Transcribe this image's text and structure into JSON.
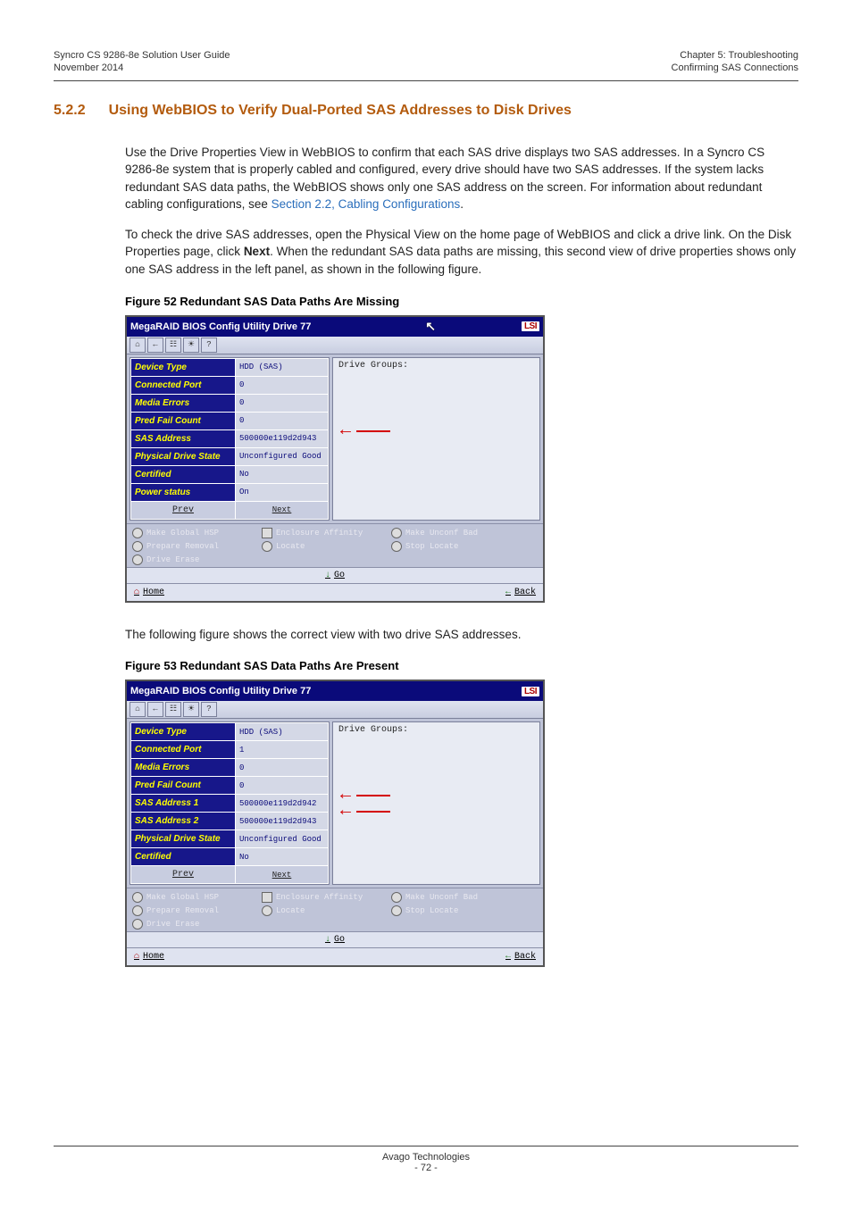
{
  "header": {
    "left_line1": "Syncro CS 9286-8e Solution User Guide",
    "left_line2": "November 2014",
    "right_line1": "Chapter 5: Troubleshooting",
    "right_line2": "Confirming SAS Connections"
  },
  "section": {
    "number": "5.2.2",
    "title": "Using WebBIOS to Verify Dual-Ported SAS Addresses to Disk Drives"
  },
  "para1_a": "Use the Drive Properties View in WebBIOS to confirm that each SAS drive displays two SAS addresses. In a Syncro CS 9286-8e system that is properly cabled and configured, every drive should have two SAS addresses. If the system lacks redundant SAS data paths, the WebBIOS shows only one SAS address on the screen. For information about redundant cabling configurations, see ",
  "para1_link": "Section 2.2, Cabling Configurations",
  "para1_b": ".",
  "para2_a": "To check the drive SAS addresses, open the Physical View on the home page of WebBIOS and click a drive link. On the Disk Properties page, click ",
  "para2_bold": "Next",
  "para2_b": ". When the redundant SAS data paths are missing, this second view of drive properties shows only one SAS address in the left panel, as shown in the following figure.",
  "fig52_caption": "Figure 52  Redundant SAS Data Paths Are Missing",
  "mid_para": "The following figure shows the correct view with two drive SAS addresses.",
  "fig53_caption": "Figure 53  Redundant SAS Data Paths Are Present",
  "bios_common": {
    "title": "MegaRAID BIOS Config Utility  Drive 77",
    "logo": "LSI",
    "drive_groups_label": "Drive Groups:",
    "prev": "Prev",
    "next": "Next",
    "go": "Go",
    "home": "Home",
    "back": "Back",
    "opts": [
      "Make Global HSP",
      "Enclosure Affinity",
      "Make Unconf Bad",
      "Prepare Removal",
      "Locate",
      "Stop Locate",
      "Drive Erase"
    ]
  },
  "fig52_rows": [
    [
      "Device Type",
      "HDD (SAS)"
    ],
    [
      "Connected Port",
      "0"
    ],
    [
      "Media Errors",
      "0"
    ],
    [
      "Pred Fail Count",
      "0"
    ],
    [
      "SAS Address",
      "500000e119d2d943"
    ],
    [
      "Physical Drive State",
      "Unconfigured Good"
    ],
    [
      "Certified",
      "No"
    ],
    [
      "Power status",
      "On"
    ]
  ],
  "fig53_rows": [
    [
      "Device Type",
      "HDD (SAS)"
    ],
    [
      "Connected Port",
      "1"
    ],
    [
      "Media Errors",
      "0"
    ],
    [
      "Pred Fail Count",
      "0"
    ],
    [
      "SAS Address 1",
      "500000e119d2d942"
    ],
    [
      "SAS Address 2",
      "500000e119d2d943"
    ],
    [
      "Physical Drive State",
      "Unconfigured Good"
    ],
    [
      "Certified",
      "No"
    ]
  ],
  "footer": {
    "company": "Avago Technologies",
    "page": "- 72 -"
  }
}
